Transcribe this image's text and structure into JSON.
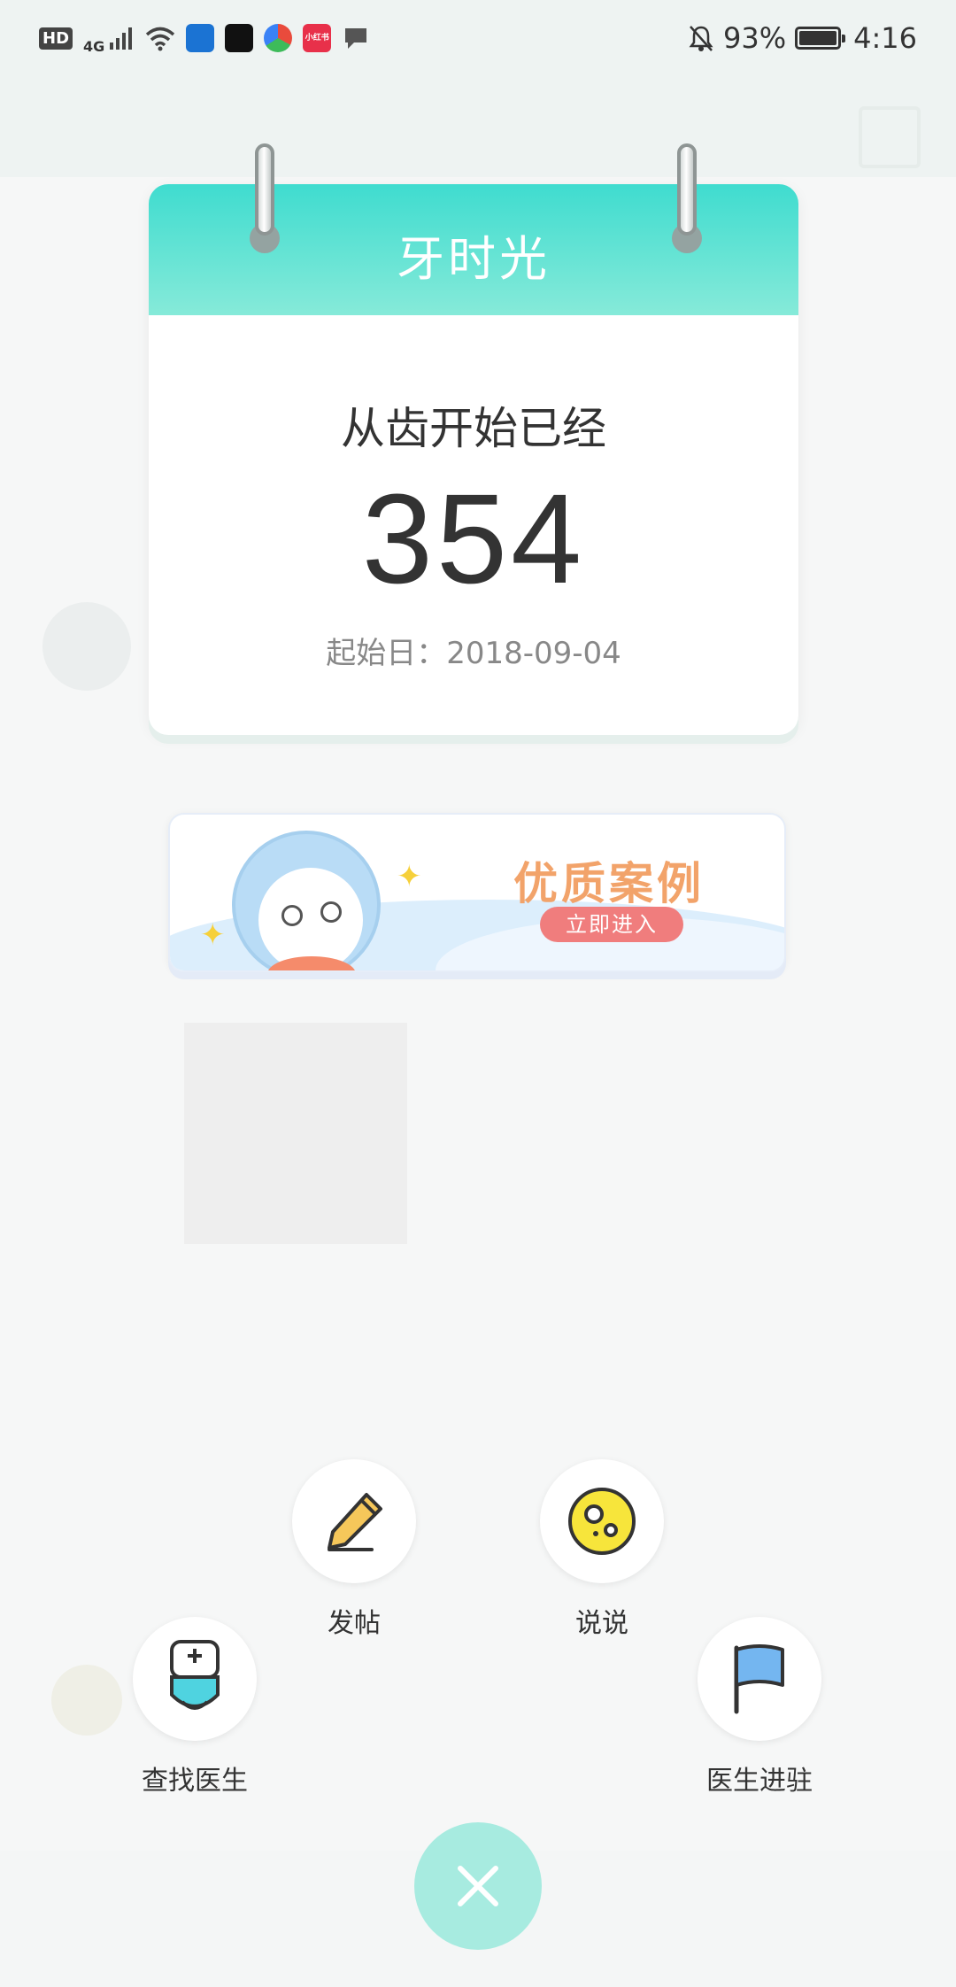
{
  "status_bar": {
    "network_hd": "HD",
    "network_gen": "4G",
    "battery": "93%",
    "time": "4:16",
    "app_icons": [
      "shield-app-icon",
      "tiktok-icon",
      "browser-icon",
      "xiaohongshu-icon",
      "chat-icon"
    ],
    "badge_xiaohongshu": "小红书"
  },
  "calendar": {
    "title": "牙时光",
    "label": "从齿开始已经",
    "count": "354",
    "start_date": "起始日：2018-09-04"
  },
  "banner": {
    "title": "优质案例",
    "button": "立即进入"
  },
  "menu": {
    "post": "发帖",
    "talk": "说说",
    "find_doctor": "查找医生",
    "doctor_join": "医生进驻"
  },
  "colors": {
    "accent": "#3fdccf",
    "close_button": "#a7ebe0",
    "banner_title": "#f2a36a",
    "banner_button": "#f07d7d"
  }
}
